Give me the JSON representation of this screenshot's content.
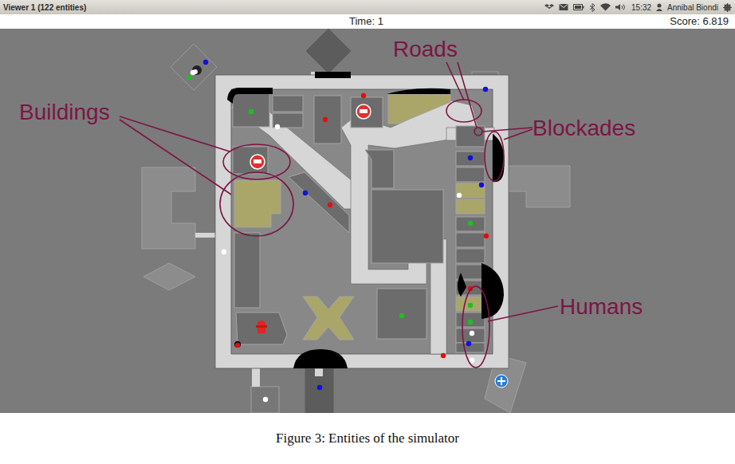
{
  "window": {
    "title": "Viewer 1 (122 entities)"
  },
  "panel": {
    "time": "15:32",
    "user": "Annibal Biondi"
  },
  "status": {
    "time": "Time: 1",
    "score": "Score: 6.819"
  },
  "annotations": [
    {
      "label": "Roads"
    },
    {
      "label": "Buildings"
    },
    {
      "label": "Blockades"
    },
    {
      "label": "Humans"
    }
  ],
  "humans": [
    {
      "color": "#1010e0"
    },
    {
      "color": "#1fbf1f"
    },
    {
      "color": "#ffffff"
    },
    {
      "color": "#1010e0"
    },
    {
      "color": "#1fbf1f"
    },
    {
      "color": "#e01010"
    },
    {
      "color": "#e01010"
    },
    {
      "color": "#ffffff"
    },
    {
      "color": "#1010e0"
    },
    {
      "color": "#1010e0"
    },
    {
      "color": "#ffffff"
    },
    {
      "color": "#1010e0"
    },
    {
      "color": "#e01010"
    },
    {
      "color": "#1fbf1f"
    },
    {
      "color": "#e01010"
    },
    {
      "color": "#ffffff"
    },
    {
      "color": "#1fbf1f"
    },
    {
      "color": "#e01010"
    },
    {
      "color": "#1fbf1f"
    },
    {
      "color": "#1fbf1f"
    },
    {
      "color": "#ffffff"
    },
    {
      "color": "#1010e0"
    },
    {
      "color": "#ffffff"
    },
    {
      "color": "#e01010"
    },
    {
      "color": "#e01010"
    },
    {
      "color": "#ffffff"
    },
    {
      "color": "#1010e0"
    }
  ],
  "caption": "Figure 3: Entities of the simulator"
}
